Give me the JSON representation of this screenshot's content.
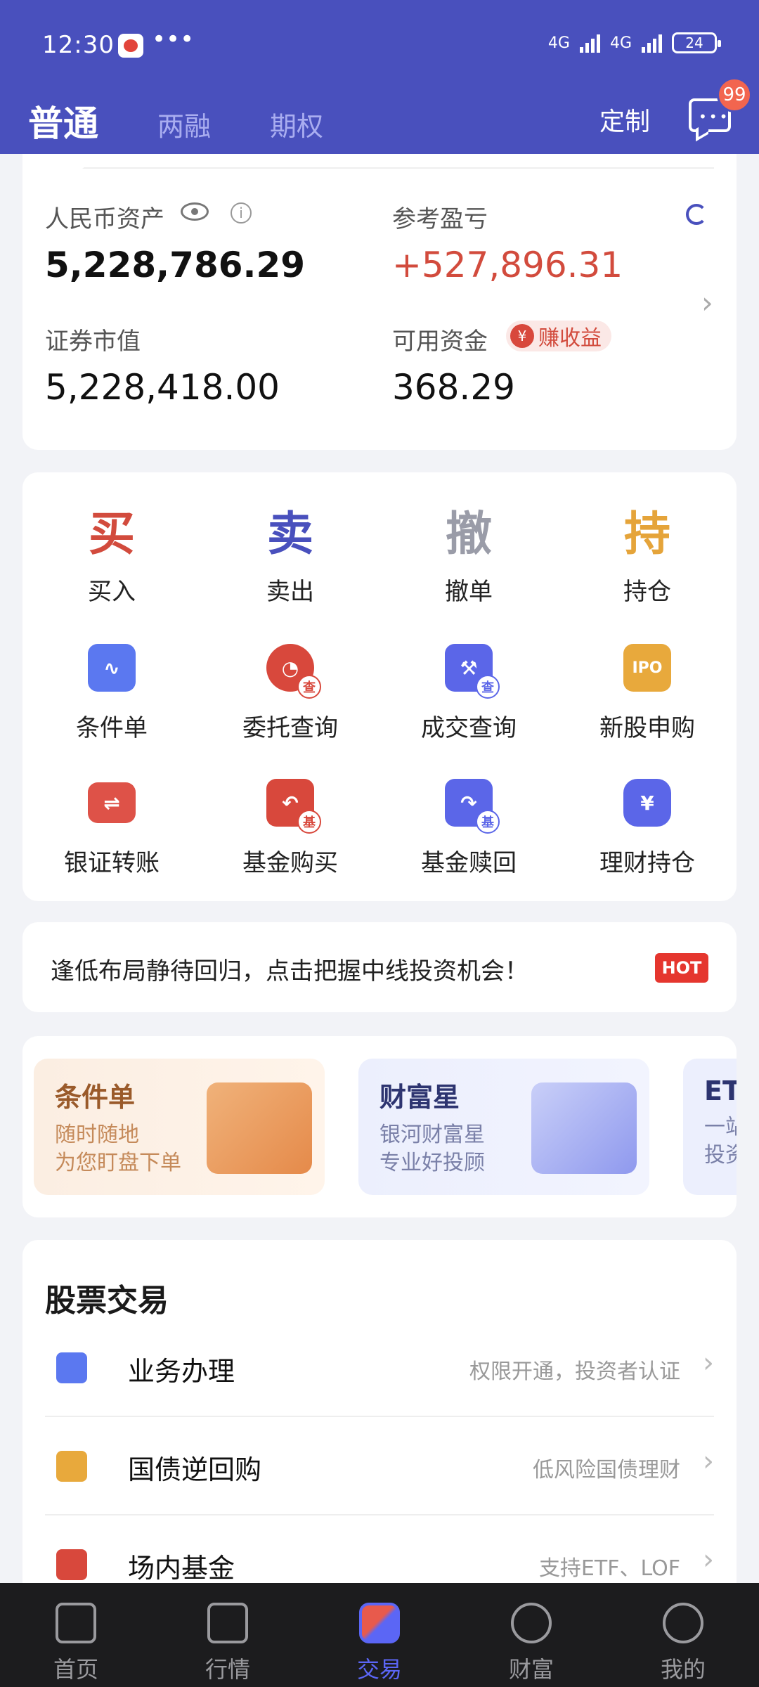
{
  "status": {
    "time": "12:30",
    "dots": "•••",
    "net1": "4G",
    "net2": "4G",
    "battery": "24"
  },
  "header": {
    "tabs": [
      "普通",
      "两融",
      "期权"
    ],
    "customize": "定制",
    "message_badge": "99"
  },
  "assets": {
    "rmb_label": "人民币资产",
    "rmb_value": "5,228,786.29",
    "pnl_label": "参考盈亏",
    "pnl_value": "+527,896.31",
    "securities_label": "证券市值",
    "securities_value": "5,228,418.00",
    "available_label": "可用资金",
    "available_value": "368.29",
    "earn_tag": "赚收益",
    "earn_coin": "¥"
  },
  "actions": {
    "primary": [
      {
        "char": "买",
        "label": "买入",
        "color": "#d24b3d"
      },
      {
        "char": "卖",
        "label": "卖出",
        "color": "#4950bd"
      },
      {
        "char": "撤",
        "label": "撤单",
        "color": "#9a9ca8"
      },
      {
        "char": "持",
        "label": "持仓",
        "color": "#e5a43a"
      }
    ],
    "secondary": [
      {
        "label": "条件单"
      },
      {
        "label": "委托查询",
        "sub": "查"
      },
      {
        "label": "成交查询",
        "sub": "查"
      },
      {
        "label": "新股申购",
        "glyph": "IPO"
      },
      {
        "label": "银证转账",
        "glyph": "⇌"
      },
      {
        "label": "基金购买",
        "sub": "基"
      },
      {
        "label": "基金赎回",
        "sub": "基"
      },
      {
        "label": "理财持仓",
        "glyph": "¥"
      }
    ]
  },
  "banner": {
    "text": "逢低布局静待回归，点击把握中线投资机会！",
    "hot": "HOT"
  },
  "promos": [
    {
      "title": "条件单",
      "line1": "随时随地",
      "line2": "为您盯盘下单"
    },
    {
      "title": "财富星",
      "line1": "银河财富星",
      "line2": "专业好投顾"
    },
    {
      "title": "ETF",
      "line1": "一站",
      "line2": "投资"
    }
  ],
  "stock": {
    "title": "股票交易",
    "rows": [
      {
        "label": "业务办理",
        "desc": "权限开通，投资者认证"
      },
      {
        "label": "国债逆回购",
        "desc": "低风险国债理财"
      },
      {
        "label": "场内基金",
        "desc": "支持ETF、LOF"
      }
    ]
  },
  "nav": [
    "首页",
    "行情",
    "交易",
    "财富",
    "我的"
  ]
}
